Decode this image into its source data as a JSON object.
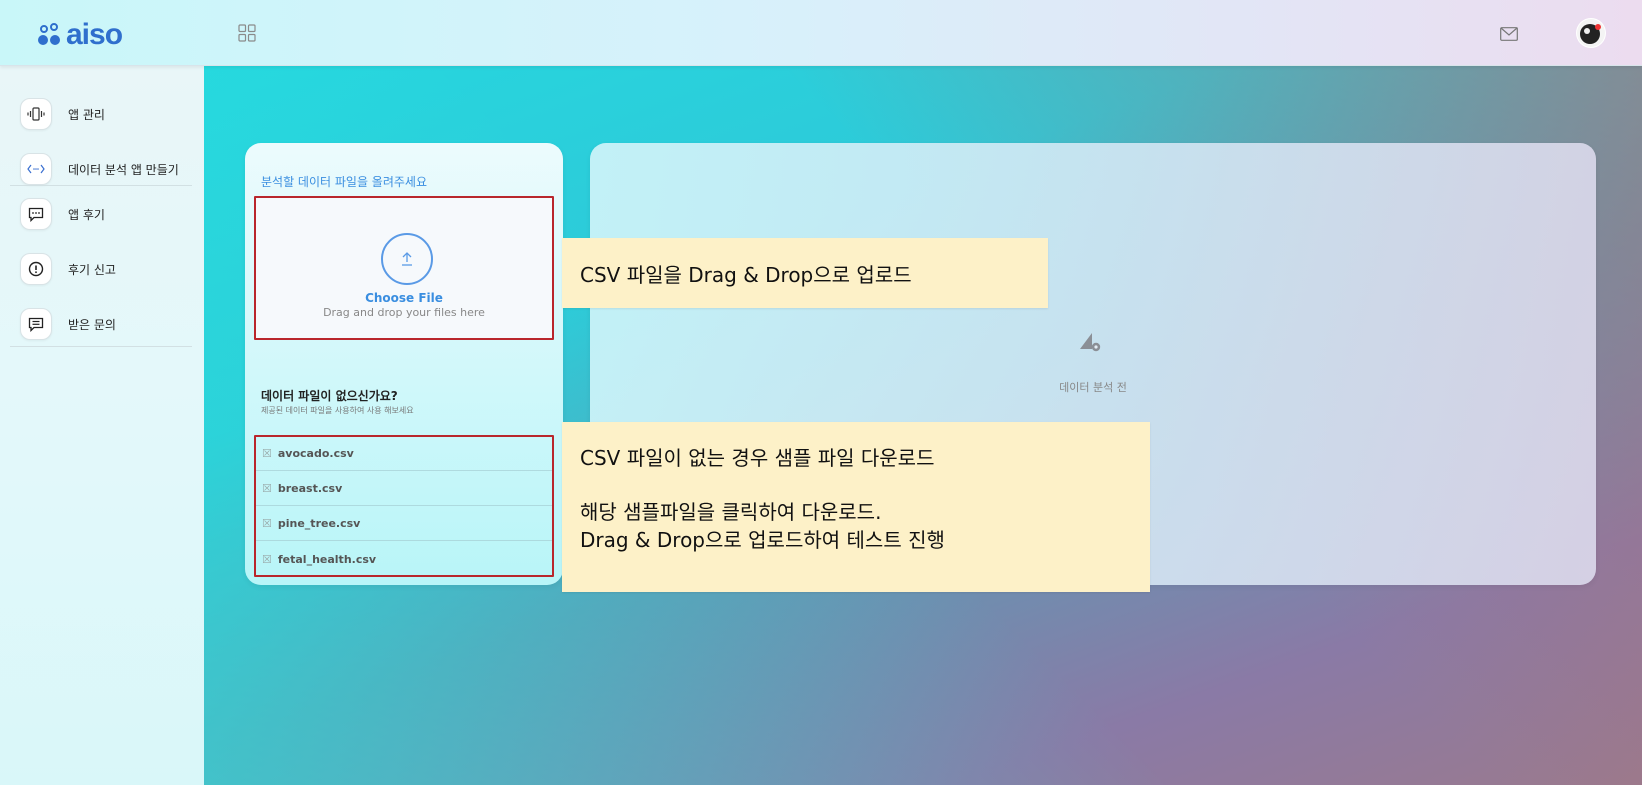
{
  "header": {
    "logo_text": "aiso",
    "icons": [
      "grid-icon",
      "mail-icon",
      "avatar"
    ]
  },
  "sidebar": {
    "items": [
      {
        "label": "앱 관리",
        "icon": "phone-vibrate-icon"
      },
      {
        "label": "데이터 분석 앱 만들기",
        "icon": "code-icon"
      },
      {
        "label": "앱 후기",
        "icon": "chat-icon"
      },
      {
        "label": "후기 신고",
        "icon": "alert-icon"
      },
      {
        "label": "받은 문의",
        "icon": "message-icon"
      }
    ]
  },
  "upload": {
    "title": "분석할 데이터 파일을 올려주세요",
    "choose_file": "Choose File",
    "drag_hint": "Drag and drop your files here",
    "no_file_question": "데이터 파일이 없으신가요?",
    "no_file_sub": "제공된 데이터 파일을 사용하여 사용 해보세요",
    "samples": [
      "avocado.csv",
      "breast.csv",
      "pine_tree.csv",
      "fetal_health.csv"
    ]
  },
  "result": {
    "status_label": "데이터 분석 전",
    "icon": "analysis-pending-icon"
  },
  "callouts": {
    "upload_note": "CSV 파일을 Drag & Drop으로 업로드",
    "sample_title": "CSV 파일이 없는 경우 샘플 파일 다운로드",
    "sample_line1": "해당 샘플파일을 클릭하여 다운로드.",
    "sample_line2": "Drag & Drop으로 업로드하여 테스트 진행"
  },
  "colors": {
    "accent": "#3a8ee0",
    "highlight_border": "#b9262c",
    "callout_bg": "#fdf1c8",
    "logo": "#2f6fcd"
  }
}
